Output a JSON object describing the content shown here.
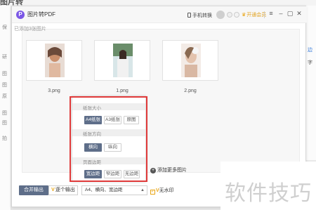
{
  "background": {
    "title": "图片转",
    "left_items": [
      "保",
      "研",
      "图",
      "图",
      "原",
      "图",
      "图",
      "拍"
    ],
    "right_items": [
      "边",
      "字"
    ]
  },
  "titlebar": {
    "logo_icon": "P",
    "title": "图片转PDF",
    "mobile_convert": "手机转换",
    "vip_label": "开通会员",
    "menu_icon": "≡",
    "minimize_icon": "–",
    "maximize_icon": "▢",
    "close_icon": "✕"
  },
  "main": {
    "added_label": "已添加3张图片",
    "thumbnails": [
      {
        "name": "3.png"
      },
      {
        "name": "1.png"
      },
      {
        "name": "2.png"
      }
    ],
    "add_more": "添加更多图片"
  },
  "dropdown": {
    "paper_size": {
      "label": "纸张大小",
      "options": [
        "A4纸张",
        "A3纸张",
        "原图"
      ],
      "selected": "A4纸张"
    },
    "orientation": {
      "label": "纸张方向",
      "options": [
        "横向",
        "纵向"
      ],
      "selected": "横向"
    },
    "margin": {
      "label": "页面边距",
      "options": [
        "宽边距",
        "窄边距",
        "无边距"
      ],
      "selected": "宽边距"
    }
  },
  "bottom": {
    "merge_output": "合并输出",
    "single_output": "逐个输出",
    "single_v": "V",
    "settings_value": "A4、横向、宽边距",
    "no_watermark": "无水印",
    "no_watermark_v": "V"
  },
  "watermark": "软件技巧",
  "colors": {
    "accent": "#5e6e89",
    "logo": "#7b57e6",
    "vip": "#e2a11c",
    "highlight": "#e03a3a"
  }
}
